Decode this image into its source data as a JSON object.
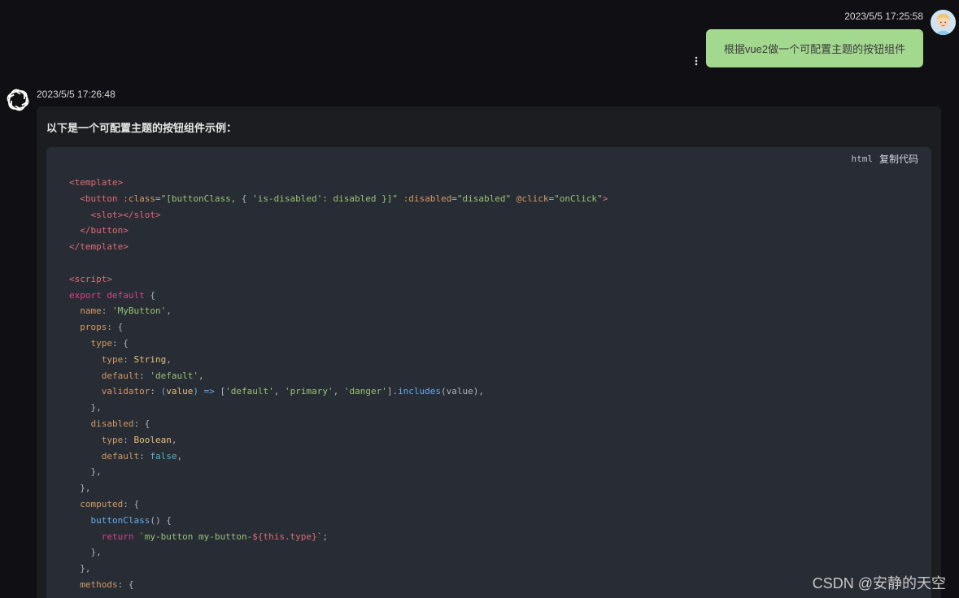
{
  "user_message": {
    "timestamp": "2023/5/5 17:25:58",
    "text": "根据vue2做一个可配置主题的按钮组件",
    "avatar_icon": "cartoon-person-avatar"
  },
  "bot_message": {
    "timestamp": "2023/5/5 17:26:48",
    "logo_icon": "openai-logo",
    "intro": "以下是一个可配置主题的按钮组件示例：",
    "code": {
      "language": "html",
      "copy_label": "复制代码",
      "lines": [
        [
          [
            "tag",
            "<template>"
          ]
        ],
        [
          [
            "plain",
            "  "
          ],
          [
            "tag",
            "<button"
          ],
          [
            "attr",
            " :class"
          ],
          [
            "plain",
            "="
          ],
          [
            "str",
            "\"[buttonClass, { 'is-disabled': disabled }]\""
          ],
          [
            "attr",
            " :disabled"
          ],
          [
            "plain",
            "="
          ],
          [
            "str",
            "\"disabled\""
          ],
          [
            "attr",
            " @click"
          ],
          [
            "plain",
            "="
          ],
          [
            "str",
            "\"onClick\""
          ],
          [
            "tag",
            ">"
          ]
        ],
        [
          [
            "plain",
            "    "
          ],
          [
            "tag",
            "<slot></slot>"
          ]
        ],
        [
          [
            "plain",
            "  "
          ],
          [
            "tag",
            "</button>"
          ]
        ],
        [
          [
            "tag",
            "</template>"
          ]
        ],
        [
          [
            "plain",
            ""
          ]
        ],
        [
          [
            "tag",
            "<script>"
          ]
        ],
        [
          [
            "kw2",
            "export default"
          ],
          [
            "plain",
            " {"
          ]
        ],
        [
          [
            "plain",
            "  "
          ],
          [
            "attr",
            "name"
          ],
          [
            "plain",
            ": "
          ],
          [
            "str",
            "'MyButton'"
          ],
          [
            "plain",
            ","
          ]
        ],
        [
          [
            "plain",
            "  "
          ],
          [
            "attr",
            "props"
          ],
          [
            "plain",
            ": {"
          ]
        ],
        [
          [
            "plain",
            "    "
          ],
          [
            "attr",
            "type"
          ],
          [
            "plain",
            ": {"
          ]
        ],
        [
          [
            "plain",
            "      "
          ],
          [
            "attr",
            "type"
          ],
          [
            "plain",
            ": "
          ],
          [
            "cls",
            "String"
          ],
          [
            "plain",
            ","
          ]
        ],
        [
          [
            "plain",
            "      "
          ],
          [
            "attr",
            "default"
          ],
          [
            "plain",
            ": "
          ],
          [
            "str",
            "'default'"
          ],
          [
            "plain",
            ","
          ]
        ],
        [
          [
            "plain",
            "      "
          ],
          [
            "attr",
            "validator"
          ],
          [
            "plain",
            ": "
          ],
          [
            "fn",
            "("
          ],
          [
            "prop",
            "value"
          ],
          [
            "fn",
            ") =>"
          ],
          [
            "plain",
            " ["
          ],
          [
            "str",
            "'default'"
          ],
          [
            "plain",
            ", "
          ],
          [
            "str",
            "'primary'"
          ],
          [
            "plain",
            ", "
          ],
          [
            "str",
            "'danger'"
          ],
          [
            "plain",
            "]."
          ],
          [
            "fn",
            "includes"
          ],
          [
            "plain",
            "(value),"
          ]
        ],
        [
          [
            "plain",
            "    },"
          ]
        ],
        [
          [
            "plain",
            "    "
          ],
          [
            "attr",
            "disabled"
          ],
          [
            "plain",
            ": {"
          ]
        ],
        [
          [
            "plain",
            "      "
          ],
          [
            "attr",
            "type"
          ],
          [
            "plain",
            ": "
          ],
          [
            "cls",
            "Boolean"
          ],
          [
            "plain",
            ","
          ]
        ],
        [
          [
            "plain",
            "      "
          ],
          [
            "attr",
            "default"
          ],
          [
            "plain",
            ": "
          ],
          [
            "num",
            "false"
          ],
          [
            "plain",
            ","
          ]
        ],
        [
          [
            "plain",
            "    },"
          ]
        ],
        [
          [
            "plain",
            "  },"
          ]
        ],
        [
          [
            "plain",
            "  "
          ],
          [
            "attr",
            "computed"
          ],
          [
            "plain",
            ": {"
          ]
        ],
        [
          [
            "plain",
            "    "
          ],
          [
            "fn",
            "buttonClass"
          ],
          [
            "plain",
            "() {"
          ]
        ],
        [
          [
            "plain",
            "      "
          ],
          [
            "kw2",
            "return"
          ],
          [
            "str",
            " `my-button my-button-"
          ],
          [
            "var",
            "${this.type}"
          ],
          [
            "str",
            "`"
          ],
          [
            "plain",
            ";"
          ]
        ],
        [
          [
            "plain",
            "    },"
          ]
        ],
        [
          [
            "plain",
            "  },"
          ]
        ],
        [
          [
            "plain",
            "  "
          ],
          [
            "attr",
            "methods"
          ],
          [
            "plain",
            ": {"
          ]
        ]
      ]
    }
  },
  "watermark": "CSDN @安静的天空"
}
